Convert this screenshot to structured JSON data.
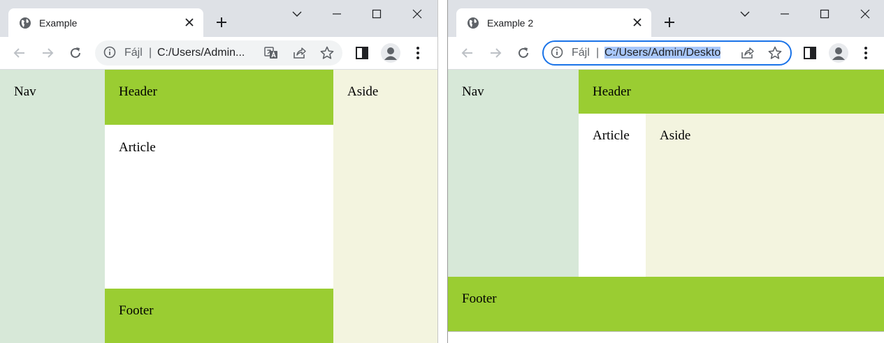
{
  "windows": [
    {
      "tab_title": "Example",
      "omnibox": {
        "scheme": "Fájl",
        "separator": "|",
        "url": "C:/Users/Admin..."
      },
      "page": {
        "nav": "Nav",
        "header": "Header",
        "article": "Article",
        "aside": "Aside",
        "footer": "Footer"
      },
      "icons": [
        "globe-icon",
        "close-icon",
        "plus-icon",
        "chevron-down-icon",
        "minimize-icon",
        "maximize-icon",
        "close-window-icon",
        "back-arrow-icon",
        "forward-arrow-icon",
        "reload-icon",
        "info-icon",
        "translate-icon",
        "share-icon",
        "star-icon",
        "side-panel-icon",
        "profile-icon",
        "kebab-menu-icon"
      ]
    },
    {
      "tab_title": "Example 2",
      "omnibox": {
        "scheme": "Fájl",
        "separator": "|",
        "url": "C:/Users/Admin/Deskto"
      },
      "page": {
        "nav": "Nav",
        "header": "Header",
        "article": "Article",
        "aside": "Aside",
        "footer": "Footer"
      },
      "icons": [
        "globe-icon",
        "close-icon",
        "plus-icon",
        "chevron-down-icon",
        "minimize-icon",
        "maximize-icon",
        "close-window-icon",
        "back-arrow-icon",
        "forward-arrow-icon",
        "reload-icon",
        "info-icon",
        "share-icon",
        "star-icon",
        "side-panel-icon",
        "profile-icon",
        "kebab-menu-icon"
      ]
    }
  ],
  "colors": {
    "tabstrip": "#dee1e6",
    "nav": "#d7e8d8",
    "header_footer": "#9acd32",
    "aside": "#f3f4df",
    "focus_ring": "#1a73e8",
    "selection": "#a8c7fa"
  }
}
